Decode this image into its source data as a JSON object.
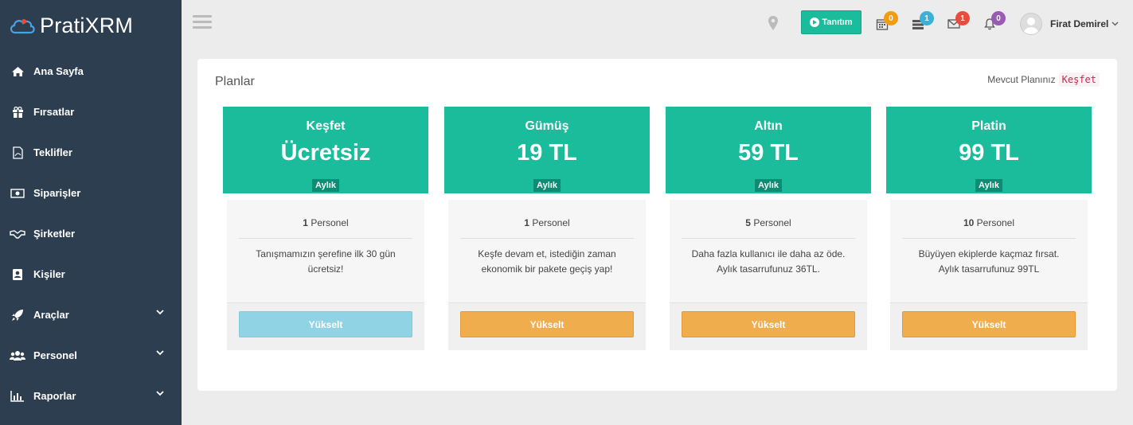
{
  "app": {
    "logo_text": "PratiXRM"
  },
  "sidebar": {
    "items": [
      {
        "label": "Ana Sayfa",
        "icon": "home-icon"
      },
      {
        "label": "Fırsatlar",
        "icon": "gift-icon"
      },
      {
        "label": "Teklifler",
        "icon": "file-pdf-icon"
      },
      {
        "label": "Siparişler",
        "icon": "money-icon"
      },
      {
        "label": "Şirketler",
        "icon": "handshake-icon"
      },
      {
        "label": "Kişiler",
        "icon": "contact-card-icon"
      },
      {
        "label": "Araçlar",
        "icon": "rocket-icon",
        "expandable": true
      },
      {
        "label": "Personel",
        "icon": "users-icon",
        "expandable": true
      },
      {
        "label": "Raporlar",
        "icon": "bar-chart-icon",
        "expandable": true
      }
    ]
  },
  "header": {
    "tour_button": "Tanıtım",
    "badges": {
      "calendar": "0",
      "tasks": "1",
      "messages": "1",
      "notifications": "0"
    },
    "badge_colors": {
      "calendar": "#f39c12",
      "tasks": "#3cb1d8",
      "messages": "#e74c3c",
      "notifications": "#9b59b6"
    },
    "user_name": "Firat Demirel"
  },
  "main": {
    "title": "Planlar",
    "current_plan_label": "Mevcut Planınız",
    "current_plan_value": "Keşfet",
    "plans": [
      {
        "name": "Keşfet",
        "price": "Ücretsiz",
        "period": "Aylık",
        "staff_count": "1",
        "staff_label": "Personel",
        "desc_line1": "Tanışmamızın şerefine ilk 30 gün",
        "desc_line2": "ücretsiz!",
        "button": "Yükselt",
        "button_color": "#8fd3e5"
      },
      {
        "name": "Gümüş",
        "price": "19 TL",
        "period": "Aylık",
        "staff_count": "1",
        "staff_label": "Personel",
        "desc_line1": "Keşfe devam et, istediğin zaman",
        "desc_line2": "ekonomik bir pakete geçiş yap!",
        "button": "Yükselt",
        "button_color": "#f0ad4e"
      },
      {
        "name": "Altın",
        "price": "59 TL",
        "period": "Aylık",
        "staff_count": "5",
        "staff_label": "Personel",
        "desc_line1": "Daha fazla kullanıcı ile daha az öde.",
        "desc_line2": "Aylık tasarrufunuz 36TL.",
        "button": "Yükselt",
        "button_color": "#f0ad4e"
      },
      {
        "name": "Platin",
        "price": "99 TL",
        "period": "Aylık",
        "staff_count": "10",
        "staff_label": "Personel",
        "desc_line1": "Büyüyen ekiplerde kaçmaz fırsat.",
        "desc_line2": "Aylık tasarrufunuz 99TL",
        "button": "Yükselt",
        "button_color": "#f0ad4e"
      }
    ]
  },
  "colors": {
    "sidebar_bg": "#2c3e50",
    "accent": "#1abc9c"
  }
}
